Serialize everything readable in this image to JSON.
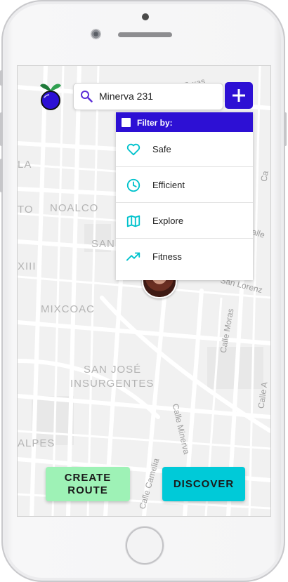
{
  "colors": {
    "brand_primary": "#2d10d4",
    "icon_teal": "#00c2cc",
    "create_route_bg": "#9ef2b6",
    "discover_bg": "#00cad8",
    "map_bg": "#f1f1f1"
  },
  "map": {
    "neighborhood_labels": [
      "LA",
      "TO",
      "NOALCO",
      "SAN",
      "XIII",
      "MIXCOAC",
      "SAN JOSÉ",
      "INSURGENTES",
      "ALPES"
    ],
    "street_labels": [
      "Texas",
      "Calle",
      "Ca",
      "San Lorenz",
      "Calle Moras",
      "Calle Minerva",
      "Calle Camelia",
      "Calle A"
    ]
  },
  "search": {
    "value": "Minerva 231",
    "icon": "search-icon",
    "add_icon": "plus-icon"
  },
  "filter": {
    "title": "Filter by:",
    "items": [
      {
        "label": "Safe",
        "icon": "heart-icon"
      },
      {
        "label": "Efficient",
        "icon": "clock-icon"
      },
      {
        "label": "Explore",
        "icon": "map-icon"
      },
      {
        "label": "Fitness",
        "icon": "trending-up-icon"
      }
    ]
  },
  "actions": {
    "create_route_line1": "CREATE",
    "create_route_line2": "ROUTE",
    "discover": "DISCOVER"
  }
}
